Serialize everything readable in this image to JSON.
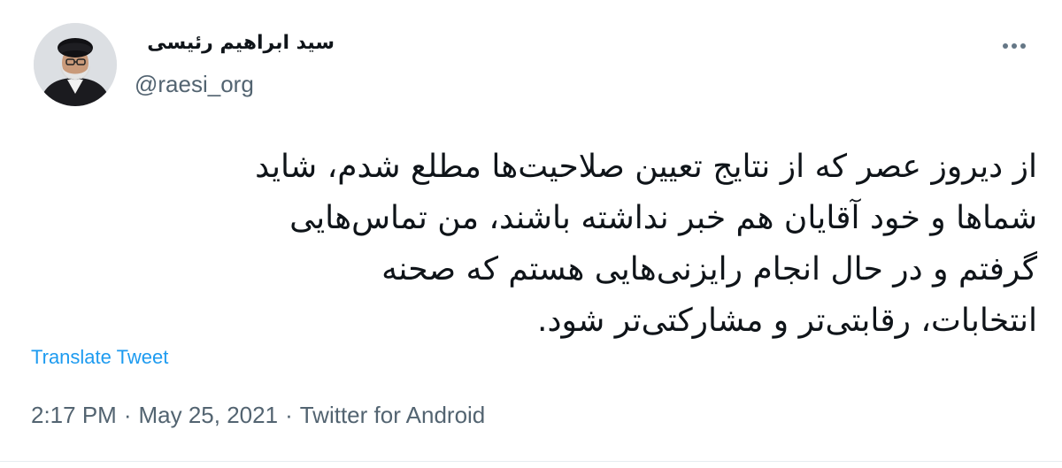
{
  "tweet": {
    "display_name": "سید ابراهیم رئیسی",
    "handle": "@raesi_org",
    "text_lines": [
      "از دیروز عصر که از نتایج تعیین صلاحیت‌ها مطلع شدم، شاید",
      "شماها و خود آقایان هم خبر نداشته باشند، من تماس‌هایی",
      "گرفتم و در حال انجام رایزنی‌هایی هستم که صحنه",
      "انتخابات، رقابتی‌تر و مشارکتی‌تر شود."
    ],
    "translate_label": "Translate Tweet",
    "time": "2:17 PM",
    "date": "May 25, 2021",
    "source": "Twitter for Android",
    "separator": "·"
  },
  "icons": {
    "more": "more-horizontal-icon",
    "avatar": "profile-photo"
  },
  "colors": {
    "link": "#1d9bf0",
    "secondary_text": "#536471",
    "primary_text": "#0f1419"
  }
}
